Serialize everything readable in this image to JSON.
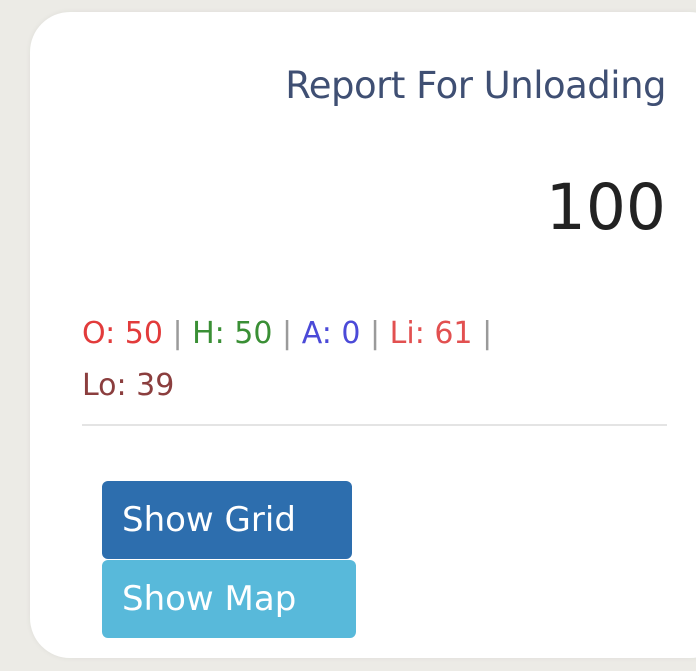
{
  "card": {
    "title": "Report For Unloading",
    "total": "100"
  },
  "stats": [
    {
      "label": "O: 50",
      "color": "#e23b3b"
    },
    {
      "label": "H: 50",
      "color": "#3a8f35"
    },
    {
      "label": "A: 0",
      "color": "#4b4ad8"
    },
    {
      "label": "Li: 61",
      "color": "#e25050"
    },
    {
      "label": "Lo: 39",
      "color": "#8b3e3e"
    }
  ],
  "separator": "|",
  "buttons": {
    "show_grid": "Show Grid",
    "show_map": "Show Map"
  },
  "colors": {
    "background": "#ecebe6",
    "card": "#ffffff",
    "title": "#3f4f73",
    "primary_button": "#2d6eae",
    "info_button": "#58b9da"
  }
}
